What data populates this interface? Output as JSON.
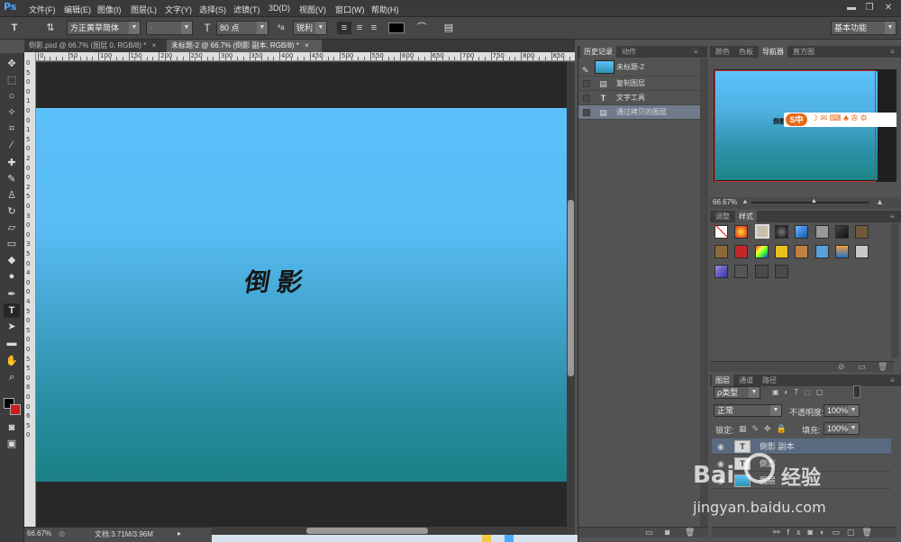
{
  "app": {
    "logo": "Ps"
  },
  "menu": [
    "文件(F)",
    "编辑(E)",
    "图像(I)",
    "图层(L)",
    "文字(Y)",
    "选择(S)",
    "滤镜(T)",
    "3D(D)",
    "视图(V)",
    "窗口(W)",
    "帮助(H)"
  ],
  "window_controls": {
    "minimize": "▬",
    "restore": "❐",
    "close": "✕"
  },
  "options": {
    "font_family": "方正黄草简体",
    "font_style": "-",
    "font_size": "80 点",
    "aa_label": "ªa",
    "antialias": "锐利",
    "workspace": "基本功能"
  },
  "doc_tabs": [
    {
      "label": "倒影.psd @ 66.7% (图层 0, RGB/8) *"
    },
    {
      "label": "未标题-2 @ 66.7% (倒影 副本, RGB/8) *"
    }
  ],
  "ruler_h": [
    "0",
    "50",
    "100",
    "150",
    "200",
    "250",
    "300",
    "350",
    "400",
    "450",
    "500",
    "550",
    "600",
    "650",
    "700",
    "750",
    "800",
    "850"
  ],
  "ruler_v": [
    "0",
    "5",
    "0",
    "0",
    "1",
    "0",
    "0",
    "1",
    "5",
    "0",
    "2",
    "0",
    "0",
    "2",
    "5",
    "0",
    "3",
    "0",
    "0",
    "3",
    "5",
    "0",
    "4",
    "0",
    "0",
    "4",
    "5",
    "0",
    "5",
    "0",
    "0",
    "5",
    "5",
    "0",
    "6",
    "0",
    "0",
    "6",
    "5",
    "0"
  ],
  "canvas": {
    "text": "倒影"
  },
  "status": {
    "zoom": "66.67%",
    "doc": "文档:3.71M/3.96M"
  },
  "history": {
    "tabs": [
      "历史记录",
      "动作"
    ],
    "snapshot": "未标题-2",
    "items": [
      {
        "label": "复制图层",
        "icon": "folder-icon"
      },
      {
        "label": "文字工具",
        "icon": "type-icon"
      },
      {
        "label": "通过拷贝的图层",
        "icon": "folder-icon"
      }
    ]
  },
  "nav": {
    "tabs": [
      "颜色",
      "色板",
      "导航器",
      "直方图"
    ],
    "zoom": "66.67%",
    "preview_text": "倒影",
    "ime_label": "S中"
  },
  "styles": {
    "tabs": [
      "调整",
      "样式"
    ]
  },
  "layers": {
    "tabs": [
      "图层",
      "通道",
      "路径"
    ],
    "filter": "ρ类型",
    "blend": "正常",
    "opacity_label": "不透明度:",
    "opacity": "100%",
    "lock_label": "锁定:",
    "fill_label": "填充:",
    "fill": "100%",
    "items": [
      {
        "name": "倒影 副本",
        "thumb": "T"
      },
      {
        "name": "倒影",
        "thumb": "T"
      },
      {
        "name": "图层",
        "thumb": ""
      }
    ]
  },
  "watermark": {
    "bai": "Bai",
    "jingyan": "经验",
    "url": "jingyan.baidu.com"
  },
  "colors": {
    "accent_blue": "#4aa8ff",
    "canvas_top": "#5cc0fb",
    "canvas_bottom": "#1a8085",
    "selection": "#6f7a8b",
    "foreground": "#000000",
    "background": "#cc1b1b"
  }
}
